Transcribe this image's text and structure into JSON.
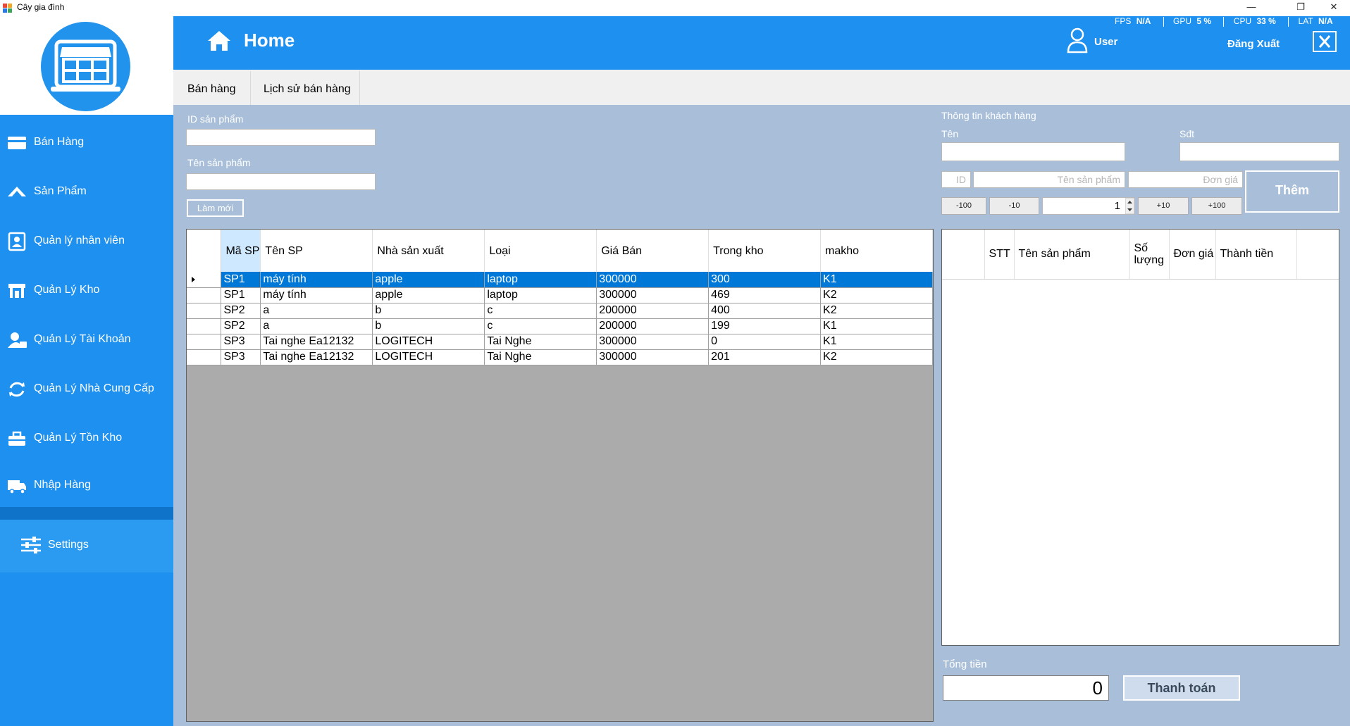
{
  "window": {
    "title": "Cây gia đình",
    "minimize_glyph": "—",
    "maximize_glyph": "❐",
    "close_glyph": "✕"
  },
  "sidebar": {
    "items": [
      {
        "label": "Bán Hàng",
        "icon": "cart-icon"
      },
      {
        "label": "Sản Phẩm",
        "icon": "plane-icon"
      },
      {
        "label": "Quản lý nhân viên",
        "icon": "id-card-icon"
      },
      {
        "label": "Quản Lý Kho",
        "icon": "warehouse-icon"
      },
      {
        "label": "Quản Lý Tài Khoản",
        "icon": "user-lock-icon"
      },
      {
        "label": "Quản Lý Nhà Cung Cấp",
        "icon": "sync-icon"
      },
      {
        "label": "Quản Lý Tồn Kho",
        "icon": "toolbox-icon"
      },
      {
        "label": "Nhập Hàng",
        "icon": "truck-icon"
      }
    ],
    "settings_label": "Settings"
  },
  "header": {
    "title": "Home",
    "stats": {
      "fps_label": "FPS",
      "fps_value": "N/A",
      "gpu_label": "GPU",
      "gpu_value": "5 %",
      "cpu_label": "CPU",
      "cpu_value": "33 %",
      "lat_label": "LAT",
      "lat_value": "N/A"
    },
    "user_label": "User",
    "logout_label": "Đăng Xuất"
  },
  "tabs": [
    {
      "label": "Bán hàng"
    },
    {
      "label": "Lịch sử bán hàng"
    }
  ],
  "search": {
    "id_label": "ID sản phẩm",
    "name_label": "Tên sản phẩm",
    "refresh_label": "Làm mới"
  },
  "customer": {
    "section_title": "Thông tin khách hàng",
    "name_label": "Tên",
    "phone_label": "Sđt",
    "id_placeholder": "ID",
    "product_name_placeholder": "Tên sản phẩm",
    "price_placeholder": "Đơn giá",
    "add_label": "Thêm",
    "minus100": "-100",
    "minus10": "-10",
    "quantity": "1",
    "plus10": "+10",
    "plus100": "+100"
  },
  "products": {
    "columns": [
      "Mã SP",
      "Tên SP",
      "Nhà sản xuất",
      "Loại",
      "Giá Bán",
      "Trong kho",
      "makho"
    ],
    "rows": [
      [
        "SP1",
        "máy tính",
        "apple",
        "laptop",
        "300000",
        "300",
        "K1"
      ],
      [
        "SP1",
        "máy tính",
        "apple",
        "laptop",
        "300000",
        "469",
        "K2"
      ],
      [
        "SP2",
        "a",
        "b",
        "c",
        "200000",
        "400",
        "K2"
      ],
      [
        "SP2",
        "a",
        "b",
        "c",
        "200000",
        "199",
        "K1"
      ],
      [
        "SP3",
        "Tai nghe Ea12132",
        "LOGITECH",
        "Tai Nghe",
        "300000",
        "0",
        "K1"
      ],
      [
        "SP3",
        "Tai nghe Ea12132",
        "LOGITECH",
        "Tai Nghe",
        "300000",
        "201",
        "K2"
      ]
    ]
  },
  "cart": {
    "columns": [
      "STT",
      "Tên sản phẩm",
      "Số lượng",
      "Đơn giá",
      "Thành tiền"
    ]
  },
  "totals": {
    "total_label": "Tổng tiền",
    "total_value": "0",
    "checkout_label": "Thanh toán"
  }
}
